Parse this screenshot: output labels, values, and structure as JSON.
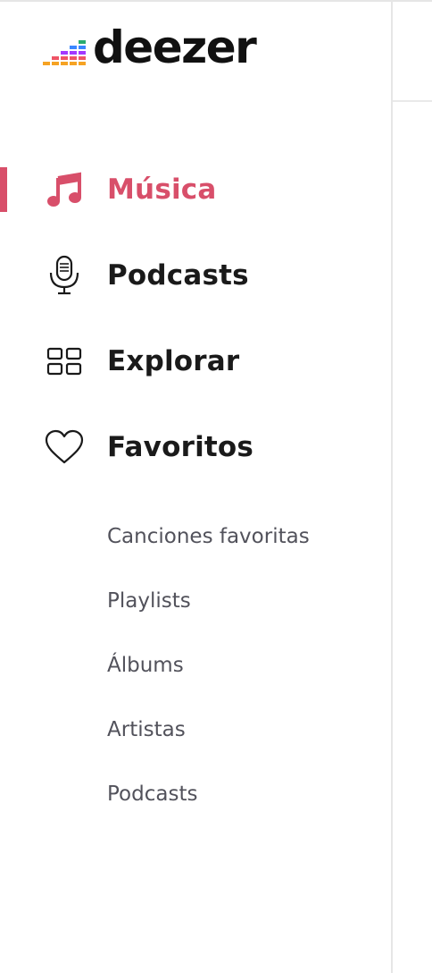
{
  "logo": {
    "wordmark": "deezer",
    "bar_colors": [
      "#f6a323",
      "#ef5466",
      "#a238ff",
      "#3a86ff",
      "#29ab70"
    ]
  },
  "sidebar": {
    "nav": [
      {
        "label": "Música",
        "icon": "music-note-icon",
        "active": true
      },
      {
        "label": "Podcasts",
        "icon": "microphone-icon",
        "active": false
      },
      {
        "label": "Explorar",
        "icon": "grid-icon",
        "active": false
      },
      {
        "label": "Favoritos",
        "icon": "heart-icon",
        "active": false
      }
    ],
    "favorites_sub": [
      {
        "label": "Canciones favoritas"
      },
      {
        "label": "Playlists"
      },
      {
        "label": "Álbums"
      },
      {
        "label": "Artistas"
      },
      {
        "label": "Podcasts"
      }
    ]
  },
  "colors": {
    "accent": "#d84f6a",
    "text_primary": "#1a1a1a",
    "text_secondary": "#52525b",
    "divider": "#e6e6e6"
  }
}
